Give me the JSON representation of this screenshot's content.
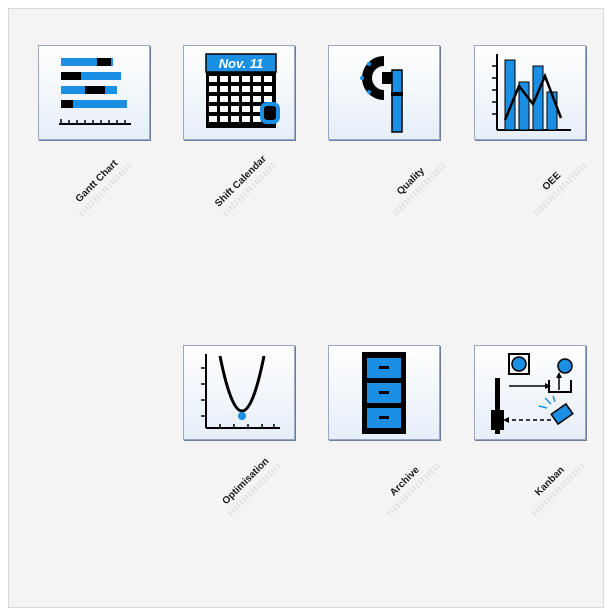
{
  "modules": {
    "gantt_chart": {
      "label": "Gantt Chart",
      "icon": "gantt-chart-icon"
    },
    "shift_calendar": {
      "label": "Shift Calendar",
      "icon": "calendar-icon",
      "date_text": "Nov. 11"
    },
    "quality": {
      "label": "Quality",
      "icon": "micrometer-icon"
    },
    "oee": {
      "label": "OEE",
      "icon": "bar-line-chart-icon"
    },
    "optimisation": {
      "label": "Optimisation",
      "icon": "parabola-graph-icon"
    },
    "archive": {
      "label": "Archive",
      "icon": "file-cabinet-icon"
    },
    "kanban": {
      "label": "Kanban",
      "icon": "kanban-flow-icon"
    }
  },
  "colors": {
    "accent_blue": "#1a8fe3",
    "icon_black": "#000000",
    "tile_border": "#98a8c4"
  }
}
